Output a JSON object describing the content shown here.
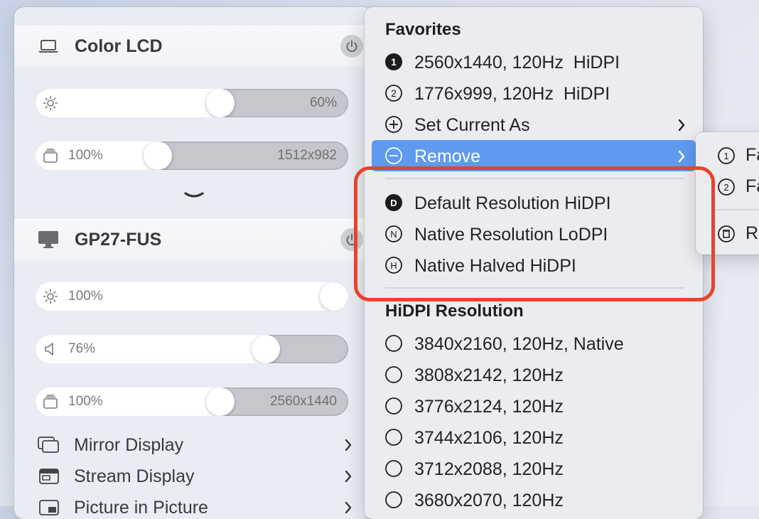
{
  "left_panel": {
    "display1": {
      "name": "Color LCD",
      "brightness": {
        "value_label": "60%",
        "level": 0.6
      },
      "resolution": {
        "value_label": "100%",
        "resolution_label": "1512x982",
        "level": 0.38
      }
    },
    "display2": {
      "name": "GP27-FUS",
      "brightness": {
        "value_label": "100%",
        "level": 1.0
      },
      "volume": {
        "value_label": "76%",
        "level": 0.76
      },
      "resolution": {
        "value_label": "100%",
        "resolution_label": "2560x1440",
        "level": 0.6
      }
    },
    "menu": [
      {
        "label": "Mirror Display"
      },
      {
        "label": "Stream Display"
      },
      {
        "label": "Picture in Picture"
      }
    ]
  },
  "center_menu": {
    "favorites_header": "Favorites",
    "favorites": [
      {
        "label": "2560x1440, 120Hz  HiDPI",
        "icon": "number-1-filled-icon"
      },
      {
        "label": "1776x999, 120Hz  HiDPI",
        "icon": "number-2-outline-icon"
      }
    ],
    "set_current_as": "Set Current As",
    "remove": "Remove",
    "presets": [
      {
        "badge": "D",
        "label": "Default Resolution HiDPI"
      },
      {
        "badge": "N",
        "label": "Native Resolution LoDPI"
      },
      {
        "badge": "H",
        "label": "Native Halved HiDPI"
      }
    ],
    "hidpi_header": "HiDPI Resolution",
    "hidpi": [
      "3840x2160, 120Hz, Native",
      "3808x2142, 120Hz",
      "3776x2124, 120Hz",
      "3744x2106, 120Hz",
      "3712x2088, 120Hz",
      "3680x2070, 120Hz"
    ]
  },
  "submenu": {
    "items": [
      {
        "badge": "1",
        "label": "Fa"
      },
      {
        "badge": "2",
        "label": "Fa"
      },
      {
        "label": "Re"
      }
    ]
  },
  "colors": {
    "highlight": "#5e9bf0",
    "annotation": "#e8432c"
  }
}
